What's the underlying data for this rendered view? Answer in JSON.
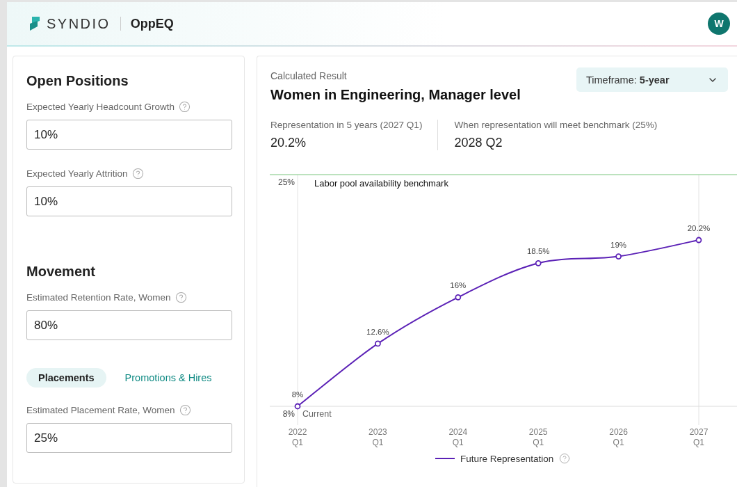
{
  "header": {
    "brand": "SYNDIO",
    "product": "OppEQ",
    "avatar": "W"
  },
  "inputs_panel": [
    {
      "kind": "heading",
      "text": "Open Positions"
    },
    {
      "kind": "field",
      "label": "Expected Yearly Headcount Growth",
      "value": "10%"
    },
    {
      "kind": "field",
      "label": "Expected Yearly Attrition",
      "value": "10%"
    },
    {
      "kind": "heading",
      "text": "Movement"
    },
    {
      "kind": "field",
      "label": "Estimated Retention Rate, Women",
      "value": "80%"
    },
    {
      "kind": "tabs",
      "tabs": [
        {
          "label": "Placements",
          "selected": true
        },
        {
          "label": "Promotions & Hires",
          "selected": false
        }
      ]
    },
    {
      "kind": "field",
      "label": "Estimated Placement Rate, Women",
      "value": "25%"
    }
  ],
  "result": {
    "eyebrow": "Calculated Result",
    "title": "Women in Engineering, Manager level",
    "timeframe": "Timeframe: **5-year**",
    "stats": [
      {
        "label": "Representation in 5 years (2027 Q1)",
        "value": "20.2%"
      },
      {
        "label": "When representation will meet benchmark (25%)",
        "value": "2028 Q2"
      }
    ],
    "chart_data": {
      "type": "line",
      "categories": [
        "2022 Q1",
        "2023 Q1",
        "2024 Q1",
        "2025 Q1",
        "2026 Q1",
        "2027 Q1"
      ],
      "series": [
        {
          "name": "Future Representation",
          "color": "#5b21b6",
          "marker": "circle",
          "values": [
            8,
            12.6,
            16,
            18.5,
            19,
            20.2
          ]
        }
      ],
      "value_labels": [
        "8%",
        "12.6%",
        "16%",
        "18.5%",
        "19%",
        "20.2%"
      ],
      "ylim": [
        8,
        25
      ],
      "yticks": [
        {
          "value": 25,
          "label": "25%"
        },
        {
          "value": 8,
          "label": "8%"
        }
      ],
      "ref_lines": [
        {
          "label": "Labor pool availability benchmark",
          "color": "#7bc67e"
        }
      ],
      "annotations": [
        {
          "text": "Current",
          "x": "2022 Q1",
          "y": 8
        }
      ]
    }
  }
}
